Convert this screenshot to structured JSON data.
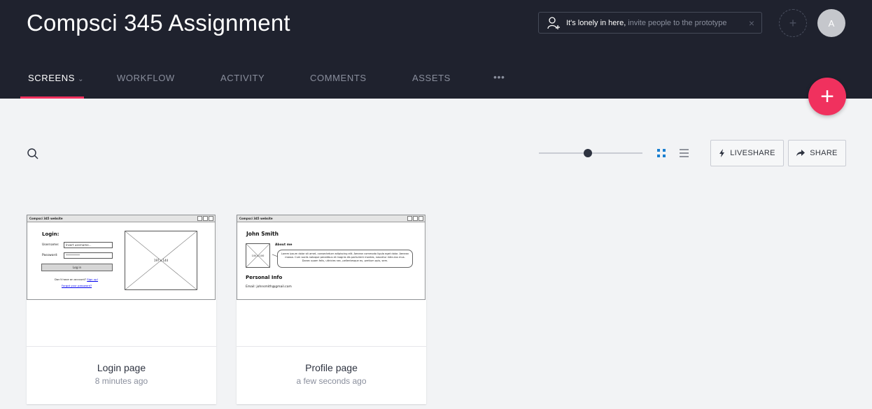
{
  "header": {
    "project_title": "Compsci 345 Assignment",
    "invite": {
      "lonely_text": "It's lonely in here,",
      "link_text": "invite people to the prototype",
      "close": "×"
    },
    "add_collaborator": "+",
    "avatar_initial": "A"
  },
  "tabs": [
    {
      "label": "SCREENS",
      "active": true
    },
    {
      "label": "WORKFLOW",
      "active": false
    },
    {
      "label": "ACTIVITY",
      "active": false
    },
    {
      "label": "COMMENTS",
      "active": false
    },
    {
      "label": "ASSETS",
      "active": false
    },
    {
      "label": "•••",
      "active": false
    }
  ],
  "fab_label": "+",
  "toolbar": {
    "zoom_level": 0.47,
    "view_mode": "grid",
    "liveshare_label": "LIVESHARE",
    "share_label": "SHARE"
  },
  "colors": {
    "header_bg": "#1f222e",
    "accent": "#f0315e",
    "view_icon_active": "#1a7fd0"
  },
  "screens": [
    {
      "name": "Login page",
      "time": "8 minutes ago",
      "wireframe": {
        "window_title": "Compsci 345 website",
        "heading": "Login:",
        "username_label": "Username:",
        "username_value": "Insert username...",
        "password_label": "Password:",
        "password_value": "**********",
        "login_button": "Log in",
        "no_account_text": "Don't have an account?",
        "signup_link": "Sign up!",
        "forgot_link": "Forgot your password?",
        "image_label": "197 x 144"
      }
    },
    {
      "name": "Profile page",
      "time": "a few seconds ago",
      "wireframe": {
        "window_title": "Compsci 345 website",
        "name_heading": "John Smith",
        "about_label": "About me",
        "image_label": "100 x 100",
        "about_text": "Lorem ipsum dolor sit amet, consectetuer adipiscing elit. Aenean commodo ligula eget dolor. Aenean massa. Cum sociis natoque penatibus et magnis dis parturient montes, nascetur ridiculus mus. Donec quam felis, ultricies nec, pellentesque eu, pretium quis, sem.",
        "personal_info_heading": "Personal Info",
        "email_text": "Email: johnsmith@gmail.com"
      }
    }
  ]
}
